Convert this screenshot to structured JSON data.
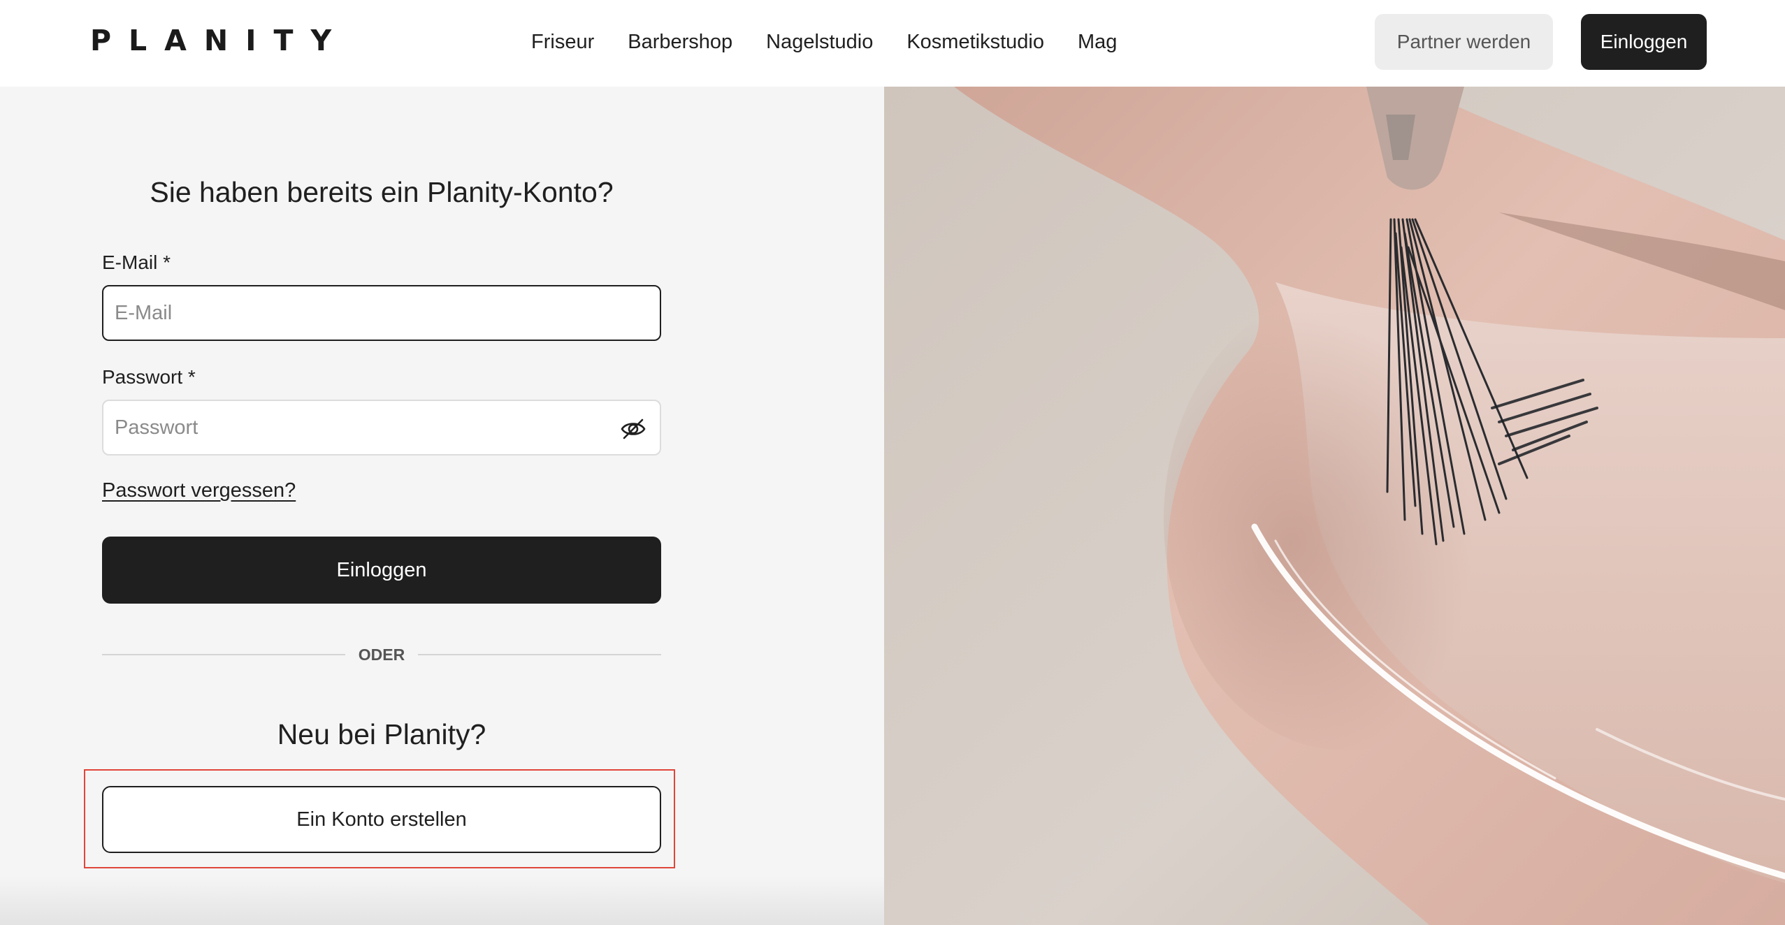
{
  "header": {
    "logo": "PLANITY",
    "nav": [
      {
        "label": "Friseur"
      },
      {
        "label": "Barbershop"
      },
      {
        "label": "Nagelstudio"
      },
      {
        "label": "Kosmetikstudio"
      },
      {
        "label": "Mag"
      }
    ],
    "partner_button": "Partner werden",
    "login_button": "Einloggen"
  },
  "login": {
    "title": "Sie haben bereits ein Planity-Konto?",
    "email_label": "E-Mail *",
    "email_placeholder": "E-Mail",
    "password_label": "Passwort *",
    "password_placeholder": "Passwort",
    "password_toggle_icon": "eye-slash-icon",
    "forgot_link": "Passwort vergessen?",
    "submit_button": "Einloggen",
    "divider_text": "ODER"
  },
  "signup": {
    "title": "Neu bei Planity?",
    "create_button": "Ein Konto erstellen"
  },
  "hero": {
    "description_icon": "nail-polish-brush-image"
  },
  "colors": {
    "primary_dark": "#1f1f1f",
    "panel_background": "#f5f5f5",
    "partner_button_bg": "#ededed",
    "highlight_border": "#e0453a"
  }
}
